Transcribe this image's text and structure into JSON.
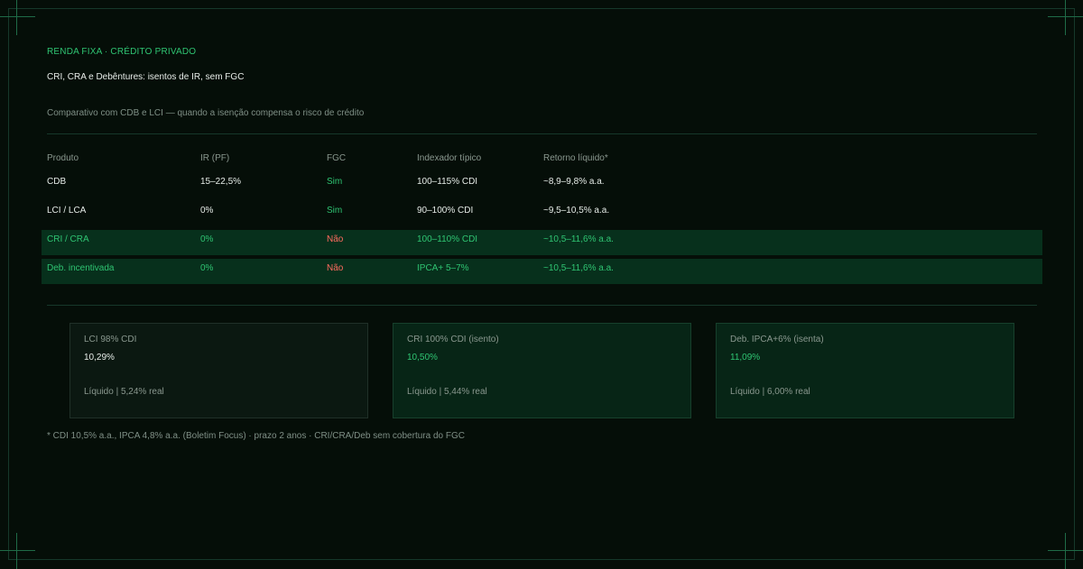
{
  "header": {
    "eyebrow": "RENDA FIXA · CRÉDITO PRIVADO",
    "title": "CRI, CRA e Debêntures: isentos de IR, sem FGC",
    "subtitle": "Comparativo com CDB e LCI — quando a isenção compensa o risco de crédito"
  },
  "table": {
    "headers": [
      "Produto",
      "IR (PF)",
      "FGC",
      "Indexador típico",
      "Retorno líquido*"
    ],
    "rows": [
      {
        "produto": "CDB",
        "ir": "15–22,5%",
        "fgc": "Sim",
        "indexador": "100–115% CDI",
        "retorno": "~8,9–9,8% a.a."
      },
      {
        "produto": "LCI / LCA",
        "ir": "0%",
        "fgc": "Sim",
        "indexador": "90–100% CDI",
        "retorno": "~9,5–10,5% a.a."
      },
      {
        "produto": "CRI / CRA",
        "ir": "0%",
        "fgc": "Não",
        "indexador": "100–110% CDI",
        "retorno": "~10,5–11,6% a.a."
      },
      {
        "produto": "Deb. incentivada",
        "ir": "0%",
        "fgc": "Não",
        "indexador": "IPCA+ 5–7%",
        "retorno": "~10,5–11,6% a.a."
      }
    ]
  },
  "cards": [
    {
      "label": "LCI 98% CDI",
      "value": "10,29%",
      "sub": "Líquido  |  5,24% real"
    },
    {
      "label": "CRI 100% CDI (isento)",
      "value": "10,50%",
      "sub": "Líquido  |  5,44% real"
    },
    {
      "label": "Deb. IPCA+6% (isenta)",
      "value": "11,09%",
      "sub": "Líquido  |  6,00% real"
    }
  ],
  "footnote": "* CDI 10,5% a.a., IPCA 4,8% a.a. (Boletim Focus) · prazo 2 anos · CRI/CRA/Deb sem cobertura do FGC",
  "colors": {
    "background": "#050e08",
    "accent": "#2fc472",
    "negative": "#ff6b5f",
    "highlight_row": "#07301c"
  }
}
